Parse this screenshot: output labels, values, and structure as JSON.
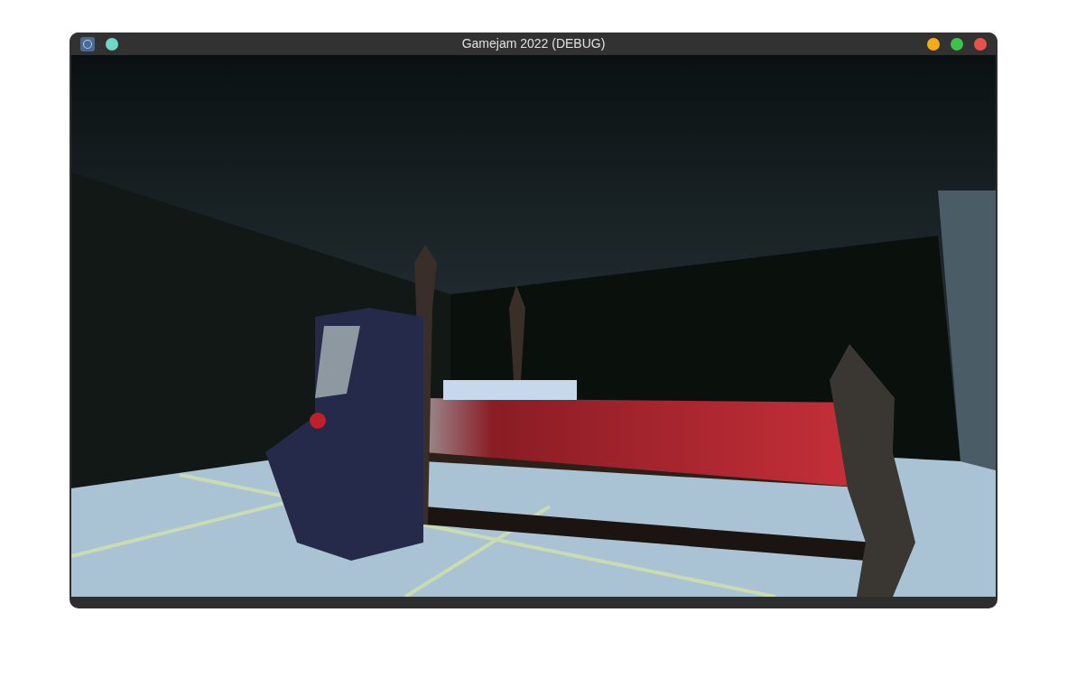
{
  "window": {
    "title": "Gamejam 2022 (DEBUG)"
  }
}
